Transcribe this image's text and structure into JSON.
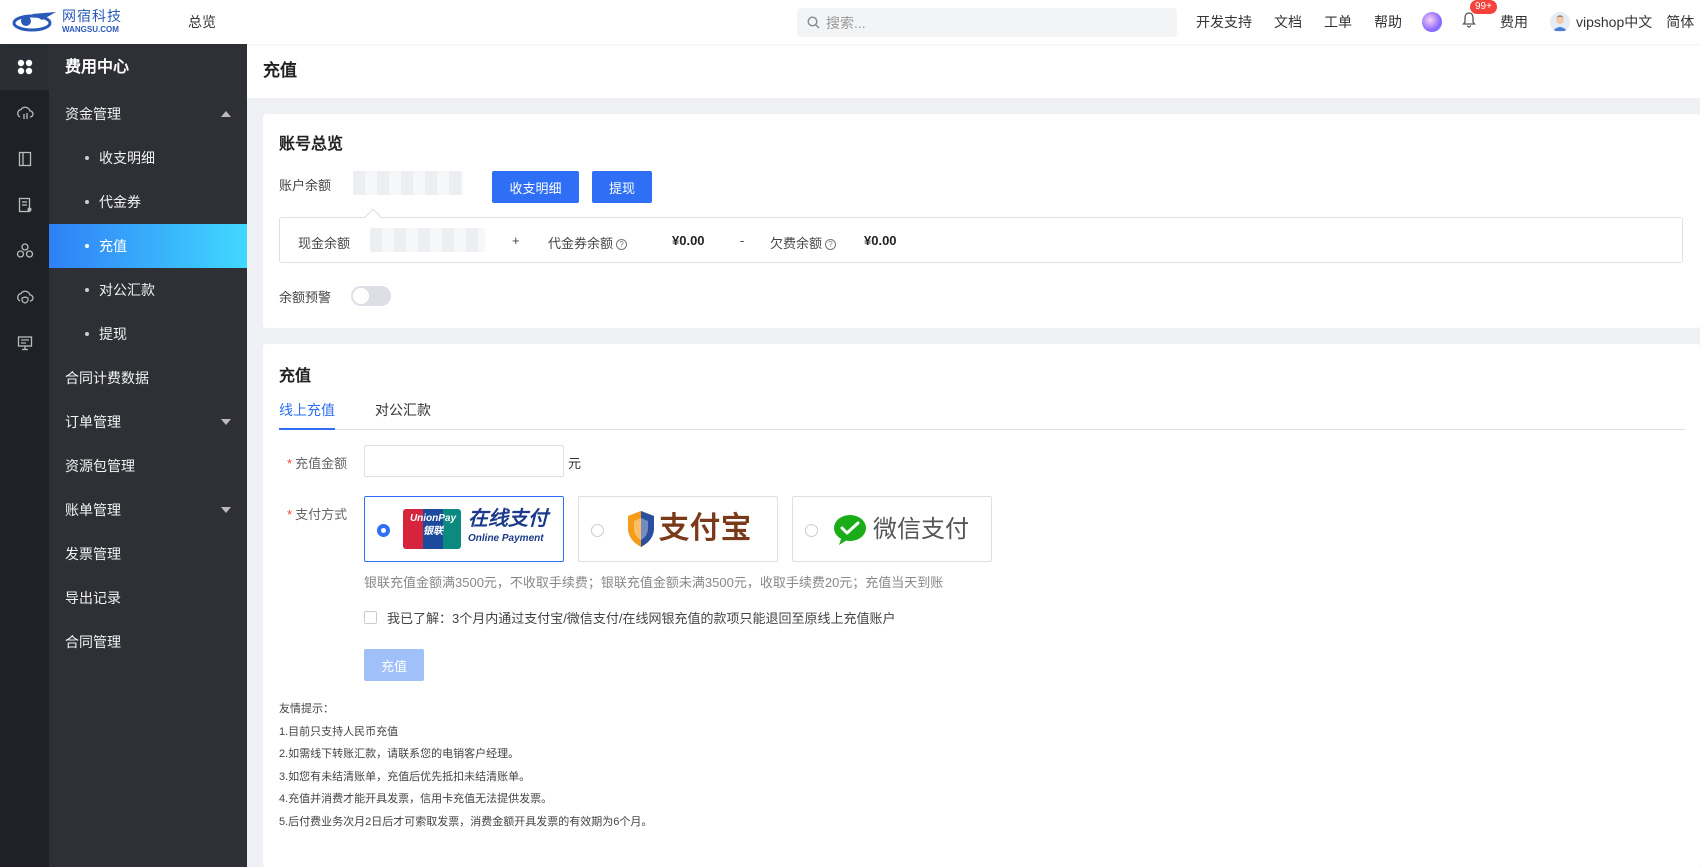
{
  "topbar": {
    "logo_cn": "网宿科技",
    "logo_en": "WANGSU.COM",
    "overview": "总览",
    "search_placeholder": "搜索...",
    "links": [
      "开发支持",
      "文档",
      "工单",
      "帮助"
    ],
    "notification_badge": "99+",
    "fees": "费用",
    "username": "vipshop中文",
    "language": "简体"
  },
  "sidebar": {
    "title": "费用中心",
    "items": [
      {
        "label": "资金管理"
      },
      {
        "label": "收支明细"
      },
      {
        "label": "代金券"
      },
      {
        "label": "充值"
      },
      {
        "label": "对公汇款"
      },
      {
        "label": "提现"
      },
      {
        "label": "合同计费数据"
      },
      {
        "label": "订单管理"
      },
      {
        "label": "资源包管理"
      },
      {
        "label": "账单管理"
      },
      {
        "label": "发票管理"
      },
      {
        "label": "导出记录"
      },
      {
        "label": "合同管理"
      }
    ]
  },
  "page": {
    "title": "充值"
  },
  "account": {
    "title": "账号总览",
    "balance_label": "账户余额",
    "detail_button": "收支明细",
    "withdraw_button": "提现",
    "cash_label": "现金余额",
    "plus": "+",
    "voucher_label": "代金券余额",
    "voucher_amount": "¥0.00",
    "minus": "-",
    "arrears_label": "欠费余额",
    "arrears_amount": "¥0.00",
    "warning_label": "余额预警",
    "warning_enabled": false
  },
  "recharge": {
    "title": "充值",
    "tabs": [
      "线上充值",
      "对公汇款"
    ],
    "amount_label": "充值金额",
    "amount_value": "",
    "unit": "元",
    "method_label": "支付方式",
    "methods": [
      {
        "name": "UnionPay",
        "name2": "银联",
        "cn": "在线支付",
        "en": "Online Payment"
      },
      {
        "name": "支付宝"
      },
      {
        "name": "微信支付"
      }
    ],
    "note": "银联充值金额满3500元，不收取手续费；银联充值金额未满3500元，收取手续费20元；充值当天到账",
    "agreement": "我已了解：3个月内通过支付宝/微信支付/在线网银充值的款项只能退回至原线上充值账户",
    "submit": "充值"
  },
  "tips": {
    "title": "友情提示：",
    "lines": [
      "1.目前只支持人民币充值",
      "2.如需线下转账汇款，请联系您的电销客户经理。",
      "3.如您有未结清账单，充值后优先抵扣未结清账单。",
      "4.充值并消费才能开具发票，信用卡充值无法提供发票。",
      "5.后付费业务次月2日后才可索取发票，消费金额开具发票的有效期为6个月。"
    ]
  },
  "colors": {
    "primary": "#2f6ff5",
    "sidebar_bg": "#2e3036",
    "rail_bg": "#1f2126"
  }
}
